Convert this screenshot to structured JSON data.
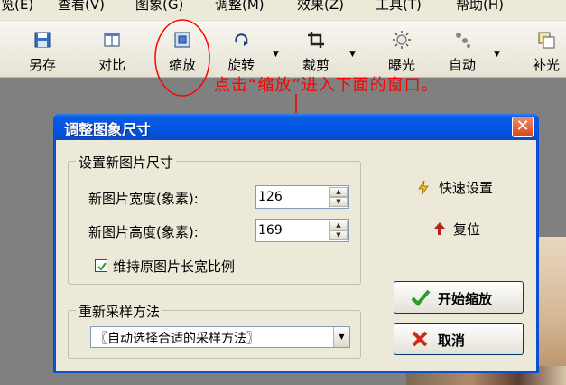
{
  "menu": {
    "items": [
      "浏览(E)",
      "查看(V)",
      "图象(G)",
      "调整(M)",
      "效果(Z)",
      "工具(T)",
      "帮助(H)"
    ]
  },
  "toolbar": {
    "save_as": "另存",
    "compare": "对比",
    "resize": "缩放",
    "rotate": "旋转",
    "crop": "裁剪",
    "exposure": "曝光",
    "auto": "自动",
    "fill_light": "补光"
  },
  "annotation": {
    "text": "点击“缩放”进入下面的窗口。",
    "color": "#ff0000"
  },
  "dialog": {
    "title": "调整图象尺寸",
    "size_group": {
      "label": "设置新图片尺寸",
      "width_label": "新图片宽度(象素):",
      "width_value": "126",
      "height_label": "新图片高度(象素):",
      "height_value": "169",
      "keep_ratio_label": "维持原图片长宽比例",
      "keep_ratio_checked": true
    },
    "resample_group": {
      "label": "重新采样方法",
      "selected": "〖自动选择合适的采样方法〗"
    },
    "quick_settings": "快速设置",
    "reset": "复位",
    "start_button": "开始缩放",
    "cancel_button": "取消"
  },
  "colors": {
    "titlebar": "#0054e3",
    "dialog_bg": "#ece9d8",
    "annotation": "#ff0000"
  }
}
